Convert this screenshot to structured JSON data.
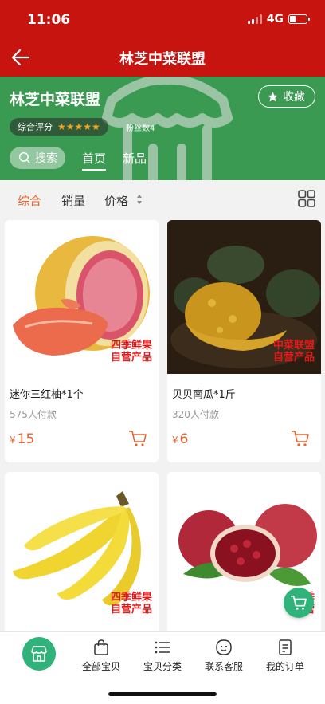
{
  "status": {
    "time": "11:06",
    "network": "4G"
  },
  "nav": {
    "title": "林芝中菜联盟"
  },
  "shop": {
    "name": "林芝中菜联盟",
    "favorite_label": "收藏",
    "rating_label": "综合评分",
    "stars": "★★★★★",
    "fans": "粉丝数4",
    "search_label": "搜索",
    "tabs": [
      "首页",
      "新品"
    ]
  },
  "sort": {
    "items": [
      "综合",
      "销量",
      "价格"
    ],
    "active": "综合"
  },
  "products": [
    {
      "name": "迷你三红柚*1个",
      "sales": "575人付款",
      "currency": "¥",
      "price": "15",
      "stamp": [
        "四季鲜果",
        "自营产品"
      ]
    },
    {
      "name": "贝贝南瓜*1斤",
      "sales": "320人付款",
      "currency": "¥",
      "price": "6",
      "stamp": [
        "中菜联盟",
        "自营产品"
      ]
    },
    {
      "name": "",
      "sales": "",
      "currency": "",
      "price": "",
      "stamp": [
        "四季鲜果",
        "自营产品"
      ]
    },
    {
      "name": "",
      "sales": "",
      "currency": "",
      "price": "",
      "stamp": [
        "四季",
        "自营"
      ]
    }
  ],
  "bottom_nav": {
    "items": [
      "全部宝贝",
      "宝贝分类",
      "联系客服",
      "我的订单"
    ]
  },
  "colors": {
    "brand_red": "#c8140f",
    "banner_green": "#3b9a52",
    "accent_orange": "#e8632a",
    "nav_green": "#2fb37b"
  }
}
